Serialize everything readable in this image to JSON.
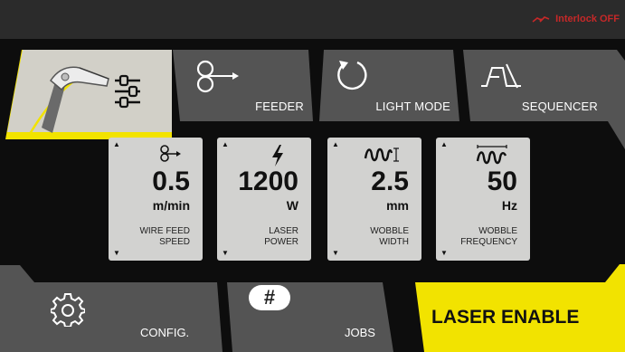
{
  "status": {
    "interlock_text": "Interlock OFF",
    "interlock_color": "#c62828"
  },
  "tabs": {
    "laser_settings": {
      "icon": "laser-gun-icon",
      "sub_icon": "sliders-icon",
      "selected": true
    },
    "feeder": {
      "label": "FEEDER",
      "icon": "wire-feeder-icon"
    },
    "light_mode": {
      "label": "LIGHT MODE",
      "icon": "circular-arrow-icon"
    },
    "sequencer": {
      "label": "SEQUENCER",
      "icon": "sequence-pulse-icon"
    }
  },
  "parameters": [
    {
      "icon": "wire-feeder-icon",
      "value": "0.5",
      "unit": "m/min",
      "name_line1": "WIRE FEED",
      "name_line2": "SPEED"
    },
    {
      "icon": "lightning-icon",
      "value": "1200",
      "unit": "W",
      "name_line1": "LASER",
      "name_line2": "POWER"
    },
    {
      "icon": "wobble-width-icon",
      "value": "2.5",
      "unit": "mm",
      "name_line1": "WOBBLE",
      "name_line2": "WIDTH"
    },
    {
      "icon": "wobble-frequency-icon",
      "value": "50",
      "unit": "Hz",
      "name_line1": "WOBBLE",
      "name_line2": "FREQUENCY"
    }
  ],
  "bottom": {
    "config_label": "CONFIG.",
    "config_icon": "gear-icon",
    "jobs_label": "JOBS",
    "jobs_icon_text": "#",
    "laser_enable_label": "LASER ENABLE"
  },
  "colors": {
    "accent_yellow": "#f2e300",
    "tab_gray": "#545454",
    "card_gray": "#d2d2d0"
  }
}
